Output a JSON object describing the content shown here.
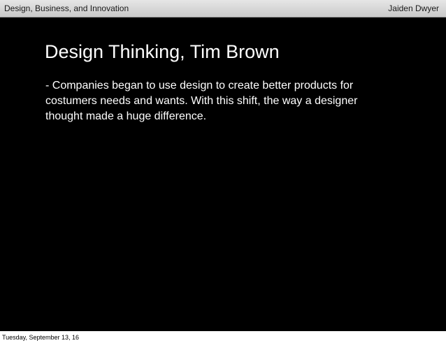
{
  "header": {
    "title": "Design, Business, and Innovation",
    "author": "Jaiden Dwyer"
  },
  "slide": {
    "title": "Design Thinking, Tim Brown",
    "body": "- Companies began to use design to create better products for costumers needs and wants. With this shift, the way a designer thought made a huge difference."
  },
  "footer": {
    "date": "Tuesday, September 13, 16"
  },
  "colors": {
    "slide_background": "#000000",
    "slide_text": "#ffffff",
    "header_bar": "#d6d6d6"
  }
}
